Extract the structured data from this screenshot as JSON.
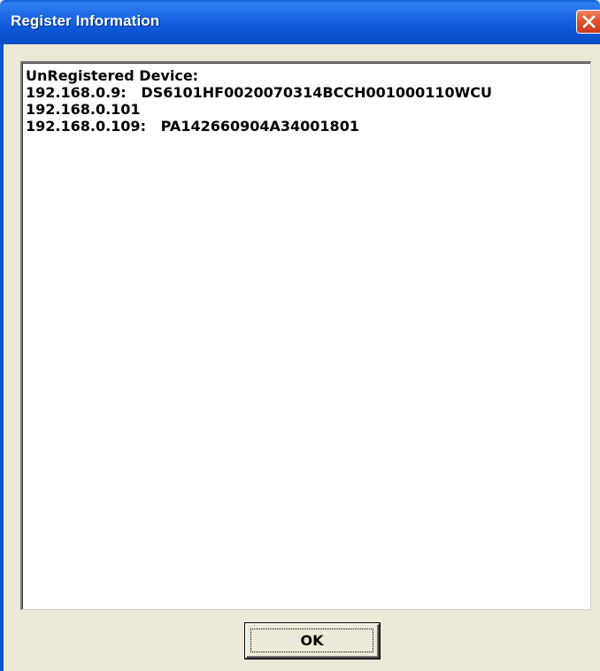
{
  "window": {
    "title": "Register Information",
    "close_icon": "close-icon"
  },
  "textbox": {
    "lines": [
      "UnRegistered Device:",
      "192.168.0.9:   DS6101HF0020070314BCCH001000110WCU",
      "192.168.0.101",
      "192.168.0.109:   PA142660904A34001801"
    ]
  },
  "buttons": {
    "ok_label": "OK"
  },
  "colors": {
    "titlebar": "#0c55d5",
    "close_button": "#e0532d",
    "dialog_background": "#ece9d8"
  }
}
